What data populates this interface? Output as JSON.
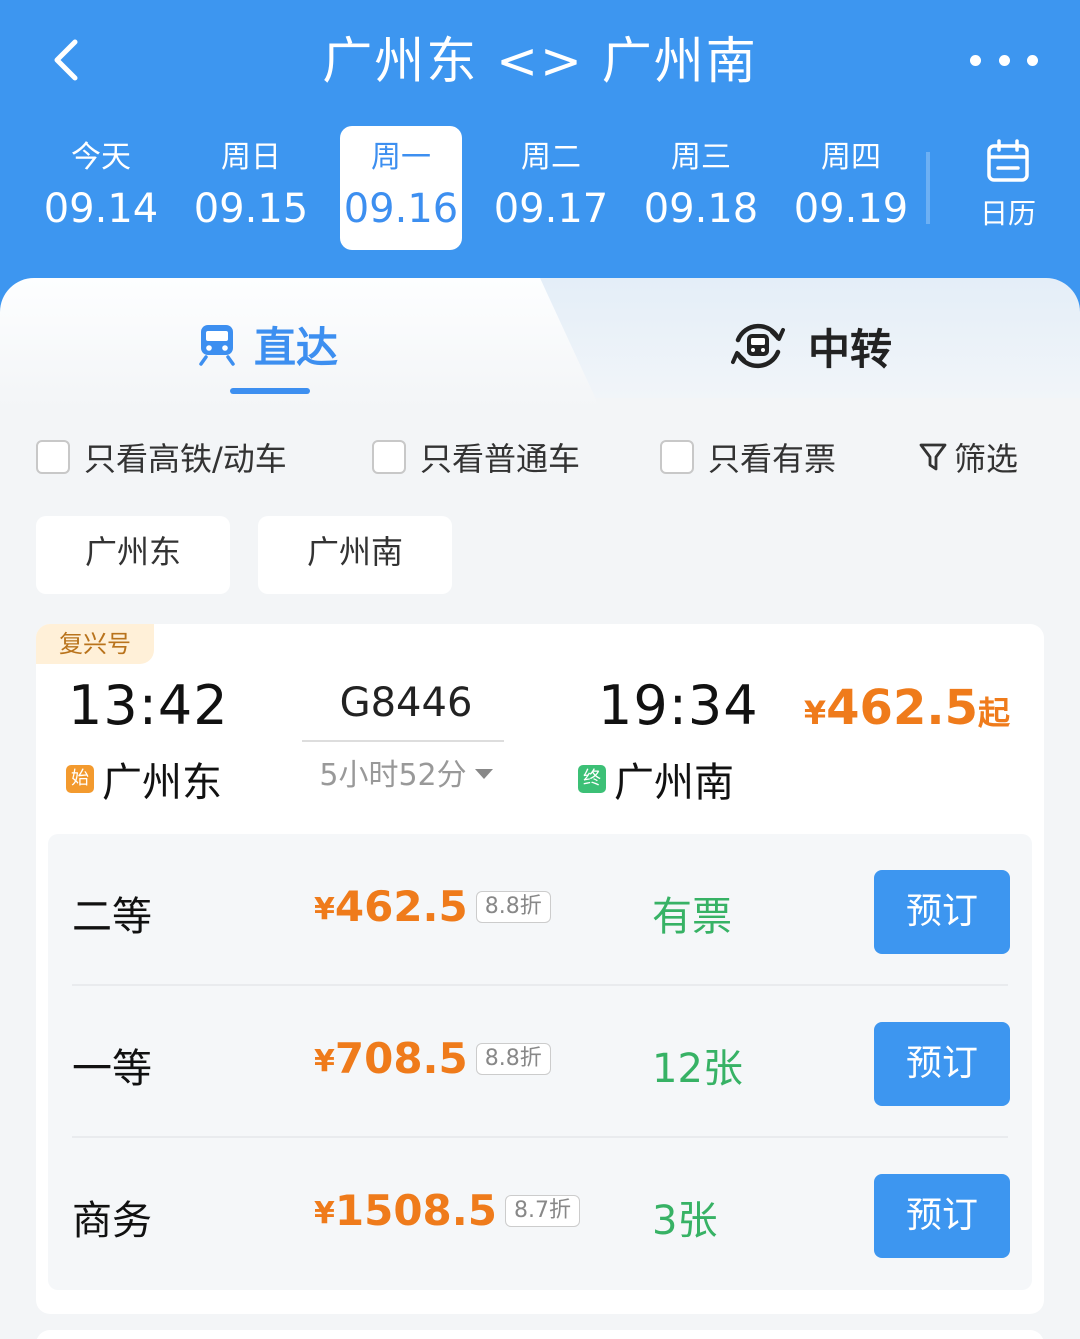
{
  "header": {
    "title": "广州东 <> 广州南",
    "dates": [
      {
        "weekday": "今天",
        "date": "09.14"
      },
      {
        "weekday": "周日",
        "date": "09.15"
      },
      {
        "weekday": "周一",
        "date": "09.16",
        "selected": true
      },
      {
        "weekday": "周二",
        "date": "09.17"
      },
      {
        "weekday": "周三",
        "date": "09.18"
      },
      {
        "weekday": "周四",
        "date": "09.19"
      }
    ],
    "calendar_label": "日历"
  },
  "tabs": {
    "direct": "直达",
    "transfer": "中转",
    "active": "direct"
  },
  "filters": {
    "high_speed": "只看高铁/动车",
    "normal": "只看普通车",
    "available": "只看有票",
    "filter_label": "筛选"
  },
  "station_chips": [
    "广州东",
    "广州南"
  ],
  "train": {
    "tag": "复兴号",
    "departure_time": "13:42",
    "departure_badge": "始",
    "departure_station": "广州东",
    "train_number": "G8446",
    "duration": "5小时52分",
    "arrival_time": "19:34",
    "arrival_badge": "终",
    "arrival_station": "广州南",
    "price_currency": "¥",
    "price_from": "462.5",
    "price_suffix": "起",
    "seats": [
      {
        "name": "二等",
        "currency": "¥",
        "price": "462.5",
        "discount": "8.8折",
        "availability": "有票",
        "button": "预订"
      },
      {
        "name": "一等",
        "currency": "¥",
        "price": "708.5",
        "discount": "8.8折",
        "availability": "12张",
        "button": "预订"
      },
      {
        "name": "商务",
        "currency": "¥",
        "price": "1508.5",
        "discount": "8.7折",
        "availability": "3张",
        "button": "预订"
      }
    ]
  },
  "colors": {
    "brand_blue": "#3d96f0",
    "price_orange": "#ef7b1b",
    "available_green": "#37b265"
  }
}
